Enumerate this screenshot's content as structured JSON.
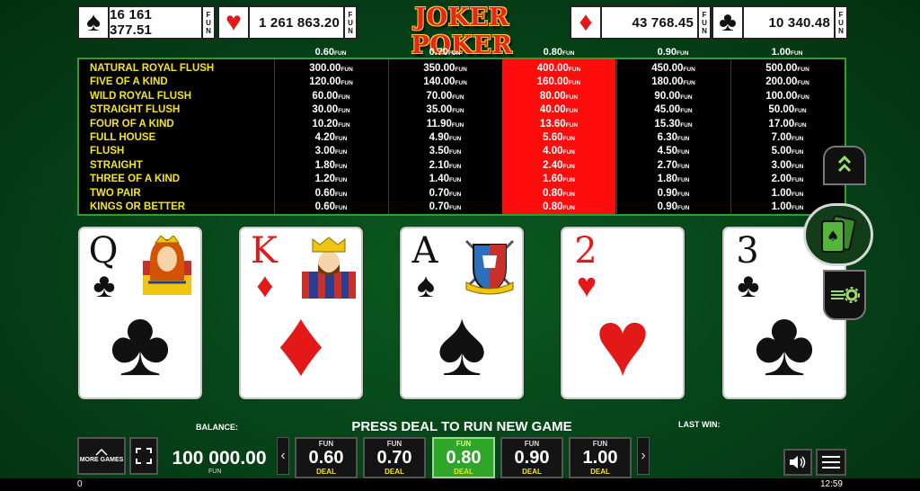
{
  "title": "JOKER POKER",
  "jackpots": [
    {
      "suit": "spade",
      "symbol": "♠",
      "value": "16 161 377.51",
      "currency": "FUN",
      "color": "black"
    },
    {
      "suit": "heart",
      "symbol": "♥",
      "value": "1 261 863.20",
      "currency": "FUN",
      "color": "red"
    },
    {
      "suit": "diamond",
      "symbol": "♦",
      "value": "43 768.45",
      "currency": "FUN",
      "color": "red"
    },
    {
      "suit": "club",
      "symbol": "♣",
      "value": "10 340.48",
      "currency": "FUN",
      "color": "black"
    }
  ],
  "bet_columns": [
    "0.60",
    "0.70",
    "0.80",
    "0.90",
    "1.00"
  ],
  "currency_suffix": "FUN",
  "selected_bet_index": 2,
  "hands": [
    "NATURAL ROYAL FLUSH",
    "FIVE OF A KIND",
    "WILD ROYAL FLUSH",
    "STRAIGHT FLUSH",
    "FOUR OF A KIND",
    "FULL HOUSE",
    "FLUSH",
    "STRAIGHT",
    "THREE OF A KIND",
    "TWO PAIR",
    "KINGS OR BETTER"
  ],
  "payouts": [
    [
      "300.00",
      "60.00",
      "10.20",
      "4.20",
      "3.00",
      "1.80",
      "1.20",
      "0.60",
      "0.60"
    ],
    [
      "350.00",
      "70.00",
      "11.90",
      "4.90",
      "3.50",
      "2.10",
      "1.40",
      "0.70",
      "0.70"
    ],
    [
      "400.00",
      "80.00",
      "13.60",
      "5.60",
      "4.00",
      "2.40",
      "1.60",
      "0.80",
      "0.80"
    ],
    [
      "450.00",
      "90.00",
      "15.30",
      "6.30",
      "4.50",
      "2.70",
      "1.80",
      "0.90",
      "0.90"
    ],
    [
      "500.00",
      "100.00",
      "17.00",
      "7.00",
      "5.00",
      "3.00",
      "2.00",
      "1.00",
      "1.00"
    ]
  ],
  "payouts_full": [
    [
      "300.00",
      "120.00",
      "60.00",
      "30.00",
      "10.20",
      "4.20",
      "3.00",
      "1.80",
      "1.20",
      "0.60",
      "0.60"
    ],
    [
      "350.00",
      "140.00",
      "70.00",
      "35.00",
      "11.90",
      "4.90",
      "3.50",
      "2.10",
      "1.40",
      "0.70",
      "0.70"
    ],
    [
      "400.00",
      "160.00",
      "80.00",
      "40.00",
      "13.60",
      "5.60",
      "4.00",
      "2.40",
      "1.60",
      "0.80",
      "0.80"
    ],
    [
      "450.00",
      "180.00",
      "90.00",
      "45.00",
      "15.30",
      "6.30",
      "4.50",
      "2.70",
      "1.80",
      "0.90",
      "0.90"
    ],
    [
      "500.00",
      "200.00",
      "100.00",
      "50.00",
      "17.00",
      "7.00",
      "5.00",
      "3.00",
      "2.00",
      "1.00",
      "1.00"
    ]
  ],
  "cards": [
    {
      "rank": "Q",
      "suit": "♣",
      "color": "black",
      "face": "queen"
    },
    {
      "rank": "K",
      "suit": "♦",
      "color": "red",
      "face": "king"
    },
    {
      "rank": "A",
      "suit": "♠",
      "color": "black",
      "face": "crest"
    },
    {
      "rank": "2",
      "suit": "♥",
      "color": "red",
      "face": ""
    },
    {
      "rank": "3",
      "suit": "♣",
      "color": "black",
      "face": ""
    }
  ],
  "labels": {
    "balance": "BALANCE:",
    "last_win": "LAST WIN:",
    "message": "PRESS DEAL TO RUN NEW GAME",
    "more_games": "MORE GAMES",
    "deal": "DEAL",
    "fun": "FUN"
  },
  "balance": {
    "value": "100 000.00",
    "currency": "FUN"
  },
  "bet_buttons": [
    "0.60",
    "0.70",
    "0.80",
    "0.90",
    "1.00"
  ],
  "footer": {
    "left": "0",
    "time": "12:59"
  },
  "side_buttons": [
    "chevrons-up-icon",
    "cards-icon",
    "autoplay-settings-icon"
  ],
  "colors": {
    "highlight": "#ff0d0d",
    "hand_text": "#f5e61a",
    "table_border": "#2e9e2e",
    "active_bet": "#2fa52a"
  }
}
